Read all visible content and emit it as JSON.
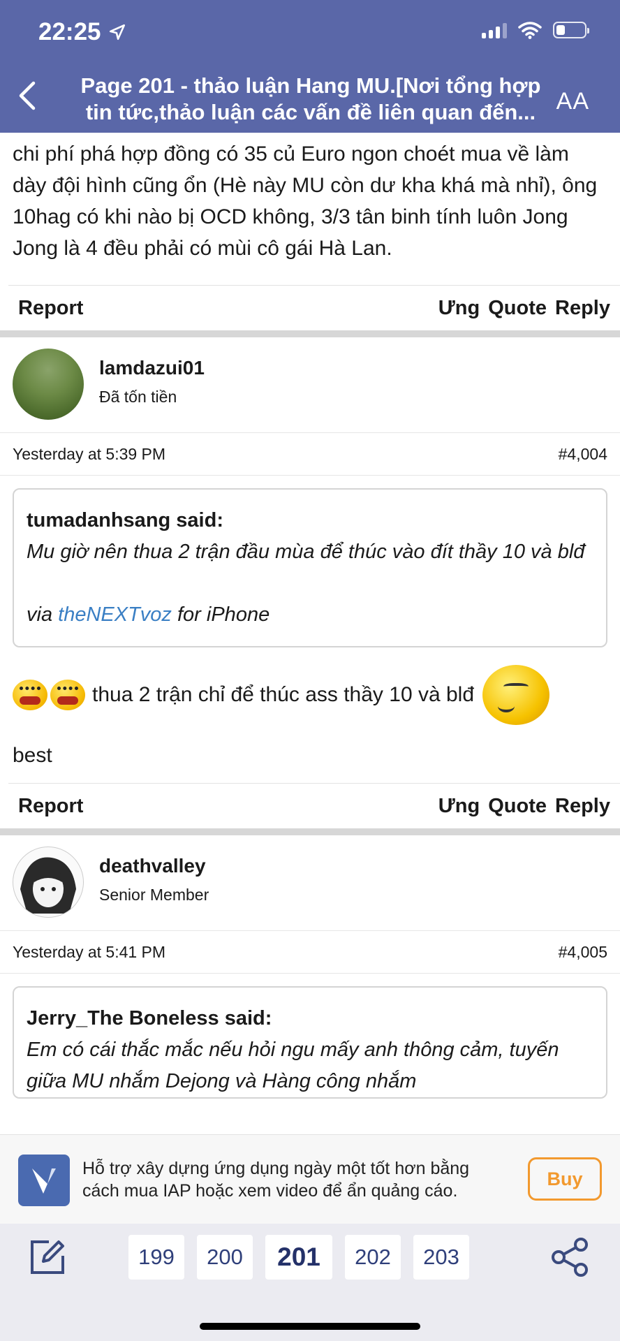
{
  "status_bar": {
    "time": "22:25"
  },
  "nav": {
    "title_line1": "Page 201 - thảo luận Hang MU.[Nơi tổng hợp",
    "title_line2": "tin tức,thảo luận các vấn đề liên quan đến...",
    "text_size_button": "AA"
  },
  "post_prev": {
    "text": "chi phí phá hợp đồng có 35 củ Euro ngon choét mua về làm dày đội hình cũng ổn (Hè này MU còn dư kha khá mà nhỉ), ông 10hag có khi nào bị OCD không, 3/3 tân binh tính luôn Jong Jong là 4 đều phải có mùi cô gái Hà Lan.",
    "report": "Report",
    "ung": "Ưng",
    "quote": "Quote",
    "reply": "Reply"
  },
  "post_4004": {
    "username": "lamdazui01",
    "user_title": "Đã tốn tiền",
    "time": "Yesterday at 5:39 PM",
    "number": "#4,004",
    "quote_author": "tumadanhsang said:",
    "quote_text": "Mu giờ nên thua 2 trận đầu mùa để thúc vào đít thầy 10 và blđ",
    "quote_via": "via",
    "quote_link": "theNEXTvoz",
    "quote_suffix": "for iPhone",
    "reply_text": "thua 2 trận chỉ để thúc ass thầy 10 và blđ",
    "reply_text2": "best",
    "report": "Report",
    "ung": "Ưng",
    "quote": "Quote",
    "reply": "Reply"
  },
  "post_4005": {
    "username": "deathvalley",
    "user_title": "Senior Member",
    "time": "Yesterday at 5:41 PM",
    "number": "#4,005",
    "quote_author": "Jerry_The Boneless said:",
    "quote_text": "Em có cái thắc mắc nếu hỏi ngu mấy anh thông cảm, tuyến giữa MU nhắm Dejong và Hàng công nhắm"
  },
  "ad": {
    "text": "Hỗ trợ xây dựng ứng dụng ngày một tốt hơn bằng cách mua IAP hoặc xem video để ẩn quảng cáo.",
    "buy": "Buy"
  },
  "pagination": {
    "pages": [
      "199",
      "200",
      "201",
      "202",
      "203"
    ],
    "current": "201"
  },
  "colors": {
    "header": "#5a67a8",
    "link": "#3a7fc4",
    "buy": "#f2992e"
  }
}
